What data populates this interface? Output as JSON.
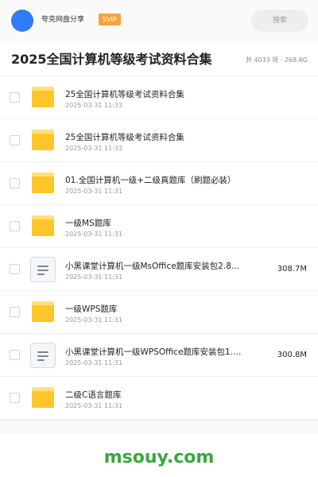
{
  "header": {
    "account_name": "夸克网盘分享",
    "badge": "SVIP",
    "search_label": "搜索"
  },
  "title_row": {
    "title": "2025全国计算机等级考试资料合集",
    "stats": "共 4033 项 · 268.6G"
  },
  "files": [
    {
      "type": "folder",
      "name": "25全国计算机等级考试资料合集",
      "date": "2025-03-31 11:33",
      "size": ""
    },
    {
      "type": "folder",
      "name": "25全国计算机等级考试资料合集",
      "date": "2025-03-31 11:33",
      "size": ""
    },
    {
      "type": "folder",
      "name": "01.全国计算机一级+二级真题库（刷题必装）",
      "date": "2025-03-31 11:31",
      "size": ""
    },
    {
      "type": "folder",
      "name": "一级MS题库",
      "date": "2025-03-31 11:31",
      "size": ""
    },
    {
      "type": "file",
      "name": "小黑课堂计算机一级MsOffice题库安装包2.8…",
      "date": "2025-03-31 11:31",
      "size": "308.7M"
    },
    {
      "type": "folder",
      "name": "一级WPS题库",
      "date": "2025-03-31 11:31",
      "size": ""
    },
    {
      "type": "file",
      "name": "小黑课堂计算机一级WPSOffice题库安装包1.…",
      "date": "2025-03-31 11:31",
      "size": "300.8M"
    },
    {
      "type": "folder",
      "name": "二级C语言题库",
      "date": "2025-03-31 11:31",
      "size": ""
    }
  ],
  "watermark": "msouy.com",
  "colors": {
    "avatar": "#2f7cf6",
    "badge": "#f7a33a",
    "folder": "#ffc62b",
    "watermark": "#3aa63f"
  }
}
